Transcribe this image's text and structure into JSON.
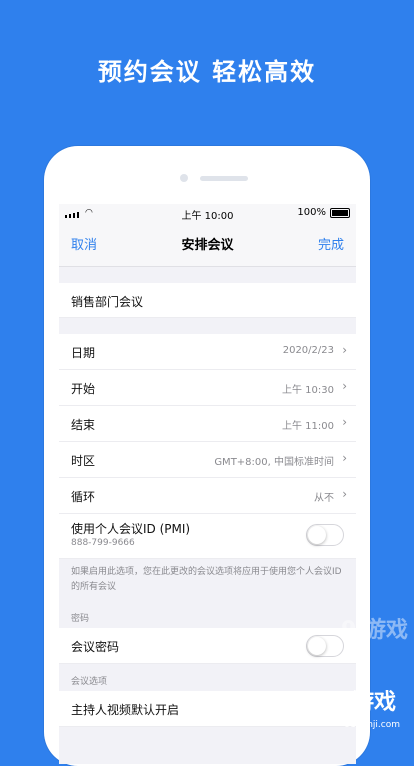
{
  "headline": "预约会议 轻松高效",
  "status_bar": {
    "time": "上午 10:00",
    "battery": "100%"
  },
  "navbar": {
    "cancel": "取消",
    "title": "安排会议",
    "done": "完成"
  },
  "meeting_title": "销售部门会议",
  "rows": [
    {
      "label": "日期",
      "value": "2020/2/23"
    },
    {
      "label": "开始",
      "value": "上午 10:30"
    },
    {
      "label": "结束",
      "value": "上午 11:00"
    },
    {
      "label": "时区",
      "value": "GMT+8:00, 中国标准时间"
    },
    {
      "label": "循环",
      "value": "从不"
    }
  ],
  "pmi": {
    "label": "使用个人会议ID (PMI)",
    "id": "888-799-9666",
    "enabled": false
  },
  "pmi_note": "如果启用此选项，您在此更改的会议选项将应用于使用您个人会议ID的所有会议",
  "password_section": {
    "header": "密码",
    "label": "会议密码",
    "enabled": false
  },
  "options_section": {
    "header": "会议选项",
    "host_video_label": "主持人视频默认开启"
  },
  "watermark": {
    "logo": "9l游戏",
    "url": "91danji.com"
  },
  "colors": {
    "brand_blue": "#2F80ED",
    "link_blue": "#2F80ED"
  }
}
